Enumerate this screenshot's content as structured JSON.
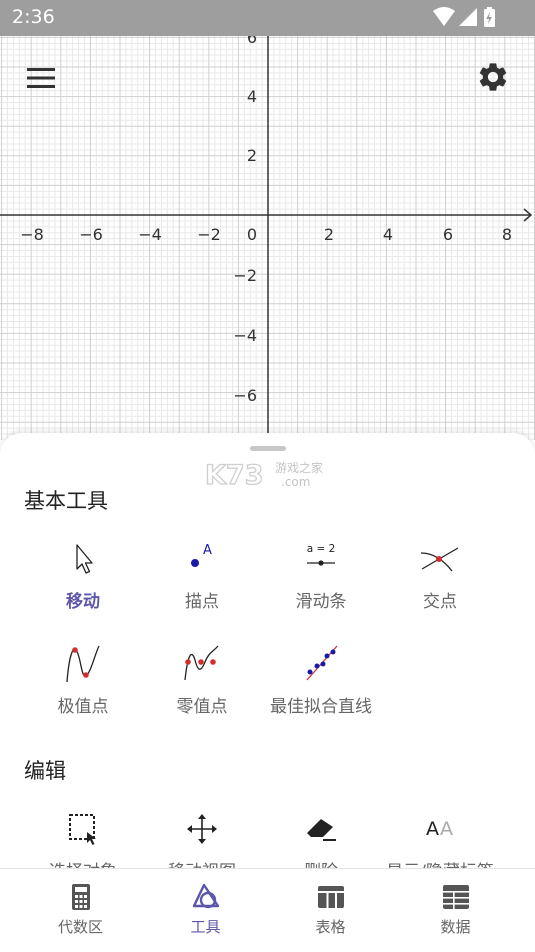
{
  "status_bar": {
    "time": "2:36"
  },
  "graph": {
    "x_labels": [
      "−8",
      "−6",
      "−4",
      "−2",
      "0",
      "2",
      "4",
      "6",
      "8"
    ],
    "y_labels_positive": [
      "6",
      "4",
      "2"
    ],
    "y_labels_negative": [
      "−2",
      "−4",
      "−6"
    ]
  },
  "watermark": {
    "main": "K73",
    "sub1": "游戏之家",
    "sub2": ".com"
  },
  "sections": {
    "basic": {
      "title": "基本工具",
      "tools": [
        {
          "label": "移动",
          "icon": "cursor-arrow-icon",
          "selected": true
        },
        {
          "label": "描点",
          "icon": "point-icon"
        },
        {
          "label": "滑动条",
          "icon": "slider-icon",
          "icon_text": "a = 2"
        },
        {
          "label": "交点",
          "icon": "intersect-icon"
        },
        {
          "label": "极值点",
          "icon": "extremum-icon"
        },
        {
          "label": "零值点",
          "icon": "roots-icon"
        },
        {
          "label": "最佳拟合直线",
          "icon": "best-fit-line-icon"
        }
      ]
    },
    "edit": {
      "title": "编辑",
      "tools": [
        {
          "label": "选择对象",
          "icon": "select-objects-icon"
        },
        {
          "label": "移动视图",
          "icon": "move-view-icon"
        },
        {
          "label": "删除",
          "icon": "eraser-icon"
        },
        {
          "label": "显示/隐藏标签",
          "icon": "show-hide-label-icon",
          "icon_text": "AA"
        }
      ]
    }
  },
  "bottom_nav": [
    {
      "label": "代数区",
      "icon": "calculator-icon"
    },
    {
      "label": "工具",
      "icon": "tools-icon",
      "active": true
    },
    {
      "label": "表格",
      "icon": "table-icon"
    },
    {
      "label": "数据",
      "icon": "data-icon"
    }
  ],
  "colors": {
    "accent": "#5c57a8",
    "point_red": "#d32f2f",
    "point_blue": "#1a1aa8",
    "status_bar": "#9e9e9e"
  }
}
